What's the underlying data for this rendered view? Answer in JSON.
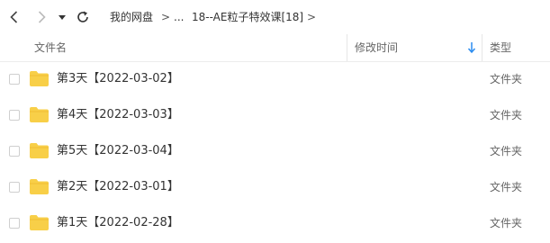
{
  "nav": {
    "breadcrumb": [
      {
        "label": "我的网盘"
      },
      {
        "label": "..."
      },
      {
        "label": "18--AE粒子特效课[18]"
      }
    ],
    "separator": ">"
  },
  "header": {
    "name_label": "文件名",
    "mtime_label": "修改时间",
    "type_label": "类型",
    "sort_color": "#2a8cf0"
  },
  "files": [
    {
      "name": "第3天【2022-03-02】",
      "type": "文件夹"
    },
    {
      "name": "第4天【2022-03-03】",
      "type": "文件夹"
    },
    {
      "name": "第5天【2022-03-04】",
      "type": "文件夹"
    },
    {
      "name": "第2天【2022-03-01】",
      "type": "文件夹"
    },
    {
      "name": "第1天【2022-02-28】",
      "type": "文件夹"
    }
  ],
  "colors": {
    "folder": "#f8cf48",
    "folder_dark": "#eeb92f"
  }
}
